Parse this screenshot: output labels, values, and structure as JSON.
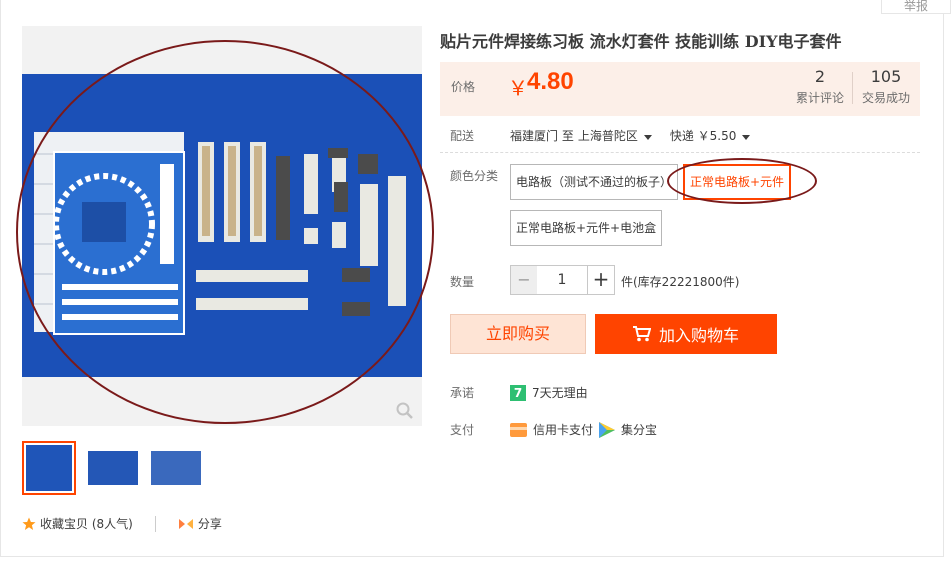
{
  "report_label": "举报",
  "product": {
    "title": "贴片元件焊接练习板 流水灯套件 技能训练 DIY电子套件"
  },
  "price": {
    "label": "价格",
    "currency": "￥",
    "value": "4.80",
    "reviews_count": "2",
    "reviews_label": "累计评论",
    "sales_count": "105",
    "sales_label": "交易成功"
  },
  "shipping": {
    "label": "配送",
    "from": "福建厦门 至",
    "to": "上海普陀区",
    "method": "快递 ￥5.50"
  },
  "options": {
    "label": "颜色分类",
    "items": [
      "电路板（测试不通过的板子）",
      "正常电路板+元件",
      "正常电路板+元件+电池盒"
    ],
    "selected": "正常电路板+元件"
  },
  "quantity": {
    "label": "数量",
    "minus": "−",
    "value": "1",
    "plus": "+",
    "stock": "件(库存22221800件)"
  },
  "actions": {
    "buy_now": "立即购买",
    "add_to_cart": "加入购物车"
  },
  "promise": {
    "label": "承诺",
    "icon_text": "7",
    "text": "7天无理由"
  },
  "payment": {
    "label": "支付",
    "method1": "信用卡支付",
    "method2": "集分宝"
  },
  "bottom": {
    "favorite": "收藏宝贝 (8人气)",
    "share": "分享"
  },
  "colors": {
    "accent": "#ff4400",
    "price_bg": "#fcefe8",
    "photo_bg": "#1b50b7",
    "annotation": "#7a1a1a"
  }
}
